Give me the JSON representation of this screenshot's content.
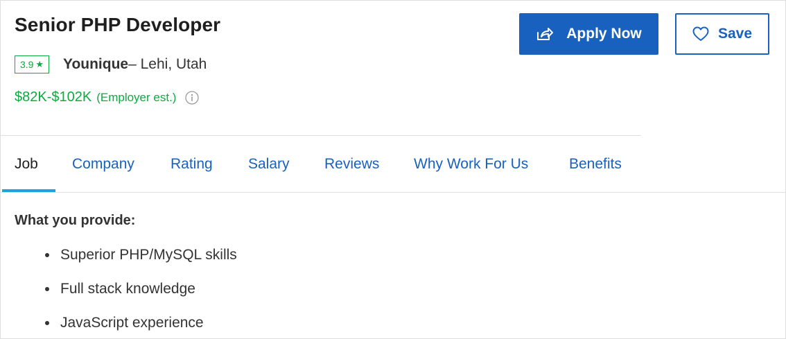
{
  "job": {
    "title": "Senior PHP Developer",
    "rating": "3.9",
    "rating_icon": "star-icon",
    "company": "Younique",
    "location": "– Lehi, Utah",
    "salary_range": "$82K-$102K",
    "salary_note": "(Employer est.)",
    "salary_info_icon": "info-icon"
  },
  "actions": {
    "apply_label": "Apply Now",
    "apply_icon": "share-arrow-icon",
    "save_label": "Save",
    "save_icon": "heart-icon"
  },
  "tabs": [
    {
      "label": "Job",
      "active": true
    },
    {
      "label": "Company",
      "active": false
    },
    {
      "label": "Rating",
      "active": false
    },
    {
      "label": "Salary",
      "active": false
    },
    {
      "label": "Reviews",
      "active": false
    },
    {
      "label": "Why Work For Us",
      "active": false
    },
    {
      "label": "Benefits",
      "active": false
    }
  ],
  "content": {
    "heading": "What you provide:",
    "bullets": [
      "Superior PHP/MySQL skills",
      "Full stack knowledge",
      "JavaScript experience"
    ]
  },
  "colors": {
    "brand_blue": "#1861bf",
    "rating_green": "#0caa41",
    "active_tab_underline": "#1fa2db"
  }
}
